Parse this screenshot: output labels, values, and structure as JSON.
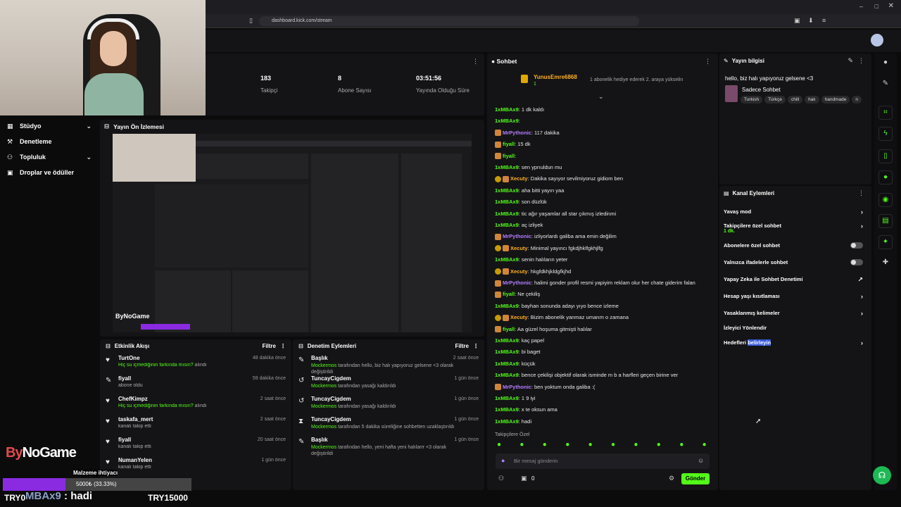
{
  "browser": {
    "url": "dashboard.kick.com/stream"
  },
  "leftnav": {
    "items": [
      {
        "label": "Stüdyo",
        "icon": "grid-icon",
        "chevron": true
      },
      {
        "label": "Denetleme",
        "icon": "gavel-icon",
        "chevron": false
      },
      {
        "label": "Topluluk",
        "icon": "users-icon",
        "chevron": true
      },
      {
        "label": "Droplar ve ödüller",
        "icon": "gift-icon",
        "chevron": false
      }
    ]
  },
  "stats": [
    {
      "value": "183",
      "label": "Takipçi"
    },
    {
      "value": "8",
      "label": "Abone Sayısı"
    },
    {
      "value": "03:51:56",
      "label": "Yayında Olduğu Süre"
    }
  ],
  "preview": {
    "title": "Yayın Ön İzlemesi"
  },
  "activity": {
    "title": "Etkinlik Akışı",
    "filter": "Filtre",
    "rows": [
      {
        "icon": "heart-add-icon",
        "name": "TurtOne",
        "sub_green": "Hiç su içmediğinin farkında mısın?",
        "sub": " alındı",
        "time": "48 dakika önce"
      },
      {
        "icon": "pin-icon",
        "name": "fiyall",
        "sub_green": "",
        "sub": "abone oldu",
        "time": "59 dakika önce"
      },
      {
        "icon": "heart-add-icon",
        "name": "ChefKimpz",
        "sub_green": "Hiç su içmediğinin farkında mısın?",
        "sub": " alındı",
        "time": "2 saat önce"
      },
      {
        "icon": "heart-icon",
        "name": "taskafa_mert",
        "sub_green": "",
        "sub": "kanalı takip etti",
        "time": "2 saat önce"
      },
      {
        "icon": "heart-icon",
        "name": "fiyall",
        "sub_green": "",
        "sub": "kanalı takip etti",
        "time": "20 saat önce"
      },
      {
        "icon": "heart-icon",
        "name": "NumanYelen",
        "sub_green": "",
        "sub": "kanalı takip etti",
        "time": "1 gün önce"
      }
    ]
  },
  "modlog": {
    "title": "Denetim Eylemleri",
    "filter": "Filtre",
    "rows": [
      {
        "icon": "pencil-icon",
        "name": "Başlık",
        "mod": "Mockermos",
        "sub": " tarafından hello, biz halı yapıyoruz gelsene <3 olarak değiştirildi",
        "time": "2 saat önce"
      },
      {
        "icon": "undo-icon",
        "name": "TuncayCigdem",
        "mod": "Mockermos",
        "sub": " tarafından yasağı kaldırıldı",
        "time": "1 gün önce"
      },
      {
        "icon": "undo-icon",
        "name": "TuncayCigdem",
        "mod": "Mockermos",
        "sub": " tarafından yasağı kaldırıldı",
        "time": "1 gün önce"
      },
      {
        "icon": "hourglass-icon",
        "name": "TuncayCigdem",
        "mod": "Mockermos",
        "sub": " tarafından 5 dakika süreliğine sohbetten uzaklaştırıldı",
        "time": "1 gün önce"
      },
      {
        "icon": "pencil-icon",
        "name": "Başlık",
        "mod": "Mockermos",
        "sub": " tarafından hello, yeni hafta yeni halılarrr <3 olarak değiştirildi",
        "time": "1 gün önce"
      }
    ]
  },
  "chat": {
    "title": "Sohbet",
    "pinned_user": "YunusEmre6868",
    "pinned_count": "1",
    "pinned_text": "1 abonelik hediye ederek 2. araya yükselin",
    "messages": [
      {
        "user": "1xMBAx9",
        "cls": "u-g",
        "text": ": 1 dk kaldı",
        "badge": ""
      },
      {
        "user": "1xMBAx9",
        "cls": "u-g",
        "text": ":",
        "badge": ""
      },
      {
        "user": "MrPythonic",
        "cls": "u-p",
        "text": ": 117 dakika",
        "badge": "b2"
      },
      {
        "user": "fiyall",
        "cls": "u-g",
        "text": ": 15 dk",
        "badge": "b2"
      },
      {
        "user": "fiyall",
        "cls": "u-g",
        "text": ":",
        "badge": "b2"
      },
      {
        "user": "1xMBAx9",
        "cls": "u-g",
        "text": ": sen yprıuldun mu",
        "badge": ""
      },
      {
        "user": "Xecuty",
        "cls": "u-o",
        "text": ": Dakika sayıyor sevilmiyoruz gidiom ben",
        "badge": "b1"
      },
      {
        "user": "1xMBAx9",
        "cls": "u-g",
        "text": ": aha bitti yayın yaa",
        "badge": ""
      },
      {
        "user": "1xMBAx9",
        "cls": "u-g",
        "text": ": son düzlük",
        "badge": ""
      },
      {
        "user": "1xMBAx9",
        "cls": "u-g",
        "text": ": tic ağır yaşamlar all star çıkmış izledinmi",
        "badge": ""
      },
      {
        "user": "1xMBAx9",
        "cls": "u-g",
        "text": ": aç izliyek",
        "badge": ""
      },
      {
        "user": "MrPythonic",
        "cls": "u-p",
        "text": ": izliyorlardı galiba ama emin değilim",
        "badge": "b2"
      },
      {
        "user": "Xecuty",
        "cls": "u-o",
        "text": ": Minimal yayıncı fgkdjhklfgkhjlfg",
        "badge": "b1"
      },
      {
        "user": "1xMBAx9",
        "cls": "u-g",
        "text": ": senin halıların yeter",
        "badge": ""
      },
      {
        "user": "Xecuty",
        "cls": "u-o",
        "text": ": hkgfdkhjkldgfkjhd",
        "badge": "b1"
      },
      {
        "user": "MrPythonic",
        "cls": "u-p",
        "text": ": halimi gonder profil resmi yapiyim reklam olur her chate giderim falan",
        "badge": "b2"
      },
      {
        "user": "fiyall",
        "cls": "u-g",
        "text": ": Ne çekiliş",
        "badge": "b2"
      },
      {
        "user": "1xMBAx9",
        "cls": "u-g",
        "text": ": bayhan sonunda adayı yıyo bence izleme",
        "badge": ""
      },
      {
        "user": "Xecuty",
        "cls": "u-o",
        "text": ": Bizim abonelik yanmaz umarım o zamana",
        "badge": "b1"
      },
      {
        "user": "fiyall",
        "cls": "u-g",
        "text": ": Aa güzel hoşuma gitmişti halılar",
        "badge": "b2"
      },
      {
        "user": "1xMBAx9",
        "cls": "u-g",
        "text": ": kaç papel",
        "badge": ""
      },
      {
        "user": "1xMBAx9",
        "cls": "u-g",
        "text": ": bi baget",
        "badge": ""
      },
      {
        "user": "1xMBAx9",
        "cls": "u-g",
        "text": ": küçük",
        "badge": ""
      },
      {
        "user": "1xMBAx9",
        "cls": "u-g",
        "text": ": bence çekilişi objektif olarak isminde m b a harfleri geçen birine ver",
        "badge": ""
      },
      {
        "user": "MrPythonic",
        "cls": "u-p",
        "text": ": ben yoktum onda galiba :(",
        "badge": "b2"
      },
      {
        "user": "1xMBAx9",
        "cls": "u-g",
        "text": ": 1 9 iyi",
        "badge": ""
      },
      {
        "user": "1xMBAx9",
        "cls": "u-g",
        "text": ": x te oksun ama",
        "badge": ""
      },
      {
        "user": "1xMBAx9",
        "cls": "u-g",
        "text": ": hadi",
        "badge": ""
      }
    ],
    "followers_only": "Takipçilere Özel",
    "input_placeholder": "Bir mesaj gönderin",
    "points": "0",
    "send": "Gönder"
  },
  "info": {
    "title": "Yayın bilgisi",
    "stream_title": "hello, biz halı yapıyoruz gelsene <3",
    "category": "Sadece Sohbet",
    "tags": [
      "Turkish",
      "Türkçe",
      "chill",
      "halı",
      "handmade",
      "n"
    ]
  },
  "actions": {
    "title": "Kanal Eylemleri",
    "rows": [
      {
        "label": "Yavaş mod",
        "extra": "",
        "ctrl": "chevron"
      },
      {
        "label": "Takipçilere özel sohbet",
        "extra": "1 dk.",
        "ctrl": "chevron"
      },
      {
        "label": "Abonelere özel sohbet",
        "extra": "",
        "ctrl": "toggle"
      },
      {
        "label": "Yalnızca ifadelerle sohbet",
        "extra": "",
        "ctrl": "toggle"
      },
      {
        "label": "Yapay Zeka ile Sohbet Denetimi",
        "extra": "",
        "ctrl": "external"
      },
      {
        "label": "Hesap yaşı kısıtlaması",
        "extra": "",
        "ctrl": "chevron"
      },
      {
        "label": "Yasaklanmış kelimeler",
        "extra": "",
        "ctrl": "chevron"
      },
      {
        "label": "İzleyici Yönlendir",
        "extra": "",
        "ctrl": ""
      },
      {
        "label": "Hedefleri ",
        "highlight": "belirleyin",
        "ctrl": "chevron"
      }
    ]
  },
  "overlay": {
    "logo_by": "By",
    "logo_rest": "NoGame",
    "goal_label": "Malzeme ihtiyacı",
    "goal_text": "5000₺ (33.33%)",
    "goal_fraction": 0.3333,
    "bottom_left": "TRY0",
    "bottom_name": "MBAx9",
    "bottom_msg": " : hadi",
    "bottom_amount": "TRY15000"
  },
  "colors": {
    "accent": "#53fc18",
    "panel": "#141416",
    "bg": "#0b0b0c"
  }
}
